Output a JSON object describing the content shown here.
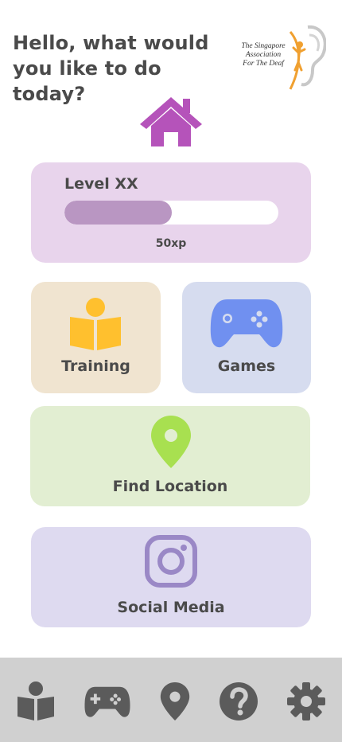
{
  "header": {
    "greeting": "Hello, what would you like to do today?",
    "logo_line1": "The Singapore",
    "logo_line2": "Association",
    "logo_line3": "For The Deaf"
  },
  "level": {
    "title": "Level XX",
    "xp_label": "50xp",
    "progress": 0.5
  },
  "tiles": {
    "training": "Training",
    "games": "Games",
    "find_location": "Find Location",
    "social_media": "Social Media"
  },
  "colors": {
    "home": "#b553ba",
    "training_icon": "#ffc02e",
    "games_icon": "#7090f0",
    "location_icon": "#a8e050",
    "social_icon": "#9a88c6",
    "nav_icon": "#5b5b5b"
  },
  "nav": {
    "items": [
      "book-reader-icon",
      "gamepad-icon",
      "map-pin-icon",
      "help-icon",
      "settings-icon"
    ]
  }
}
